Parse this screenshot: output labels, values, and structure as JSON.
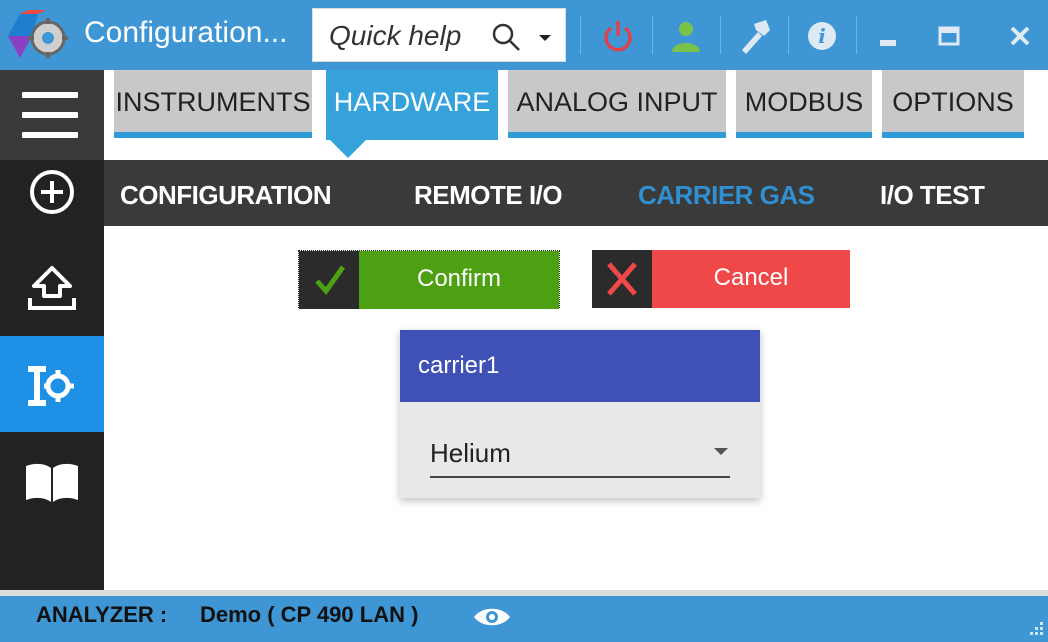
{
  "window": {
    "title": "Configuration...",
    "quick_help_placeholder": "Quick help",
    "icons": [
      "app-logo-icon",
      "search-icon",
      "chevron-down-icon",
      "power-icon",
      "user-icon",
      "tools-icon",
      "info-icon",
      "minimize-icon",
      "maximize-icon",
      "close-icon"
    ]
  },
  "sidebar": {
    "items": [
      {
        "icon": "menu-icon"
      },
      {
        "icon": "add-icon"
      },
      {
        "icon": "upload-icon"
      },
      {
        "icon": "settings-tools-icon",
        "active": true
      },
      {
        "icon": "book-icon"
      }
    ]
  },
  "tabs": [
    {
      "label": "INSTRUMENTS"
    },
    {
      "label": "HARDWARE",
      "active": true
    },
    {
      "label": "ANALOG INPUT"
    },
    {
      "label": "MODBUS"
    },
    {
      "label": "OPTIONS"
    }
  ],
  "subtabs": [
    {
      "label": "CONFIGURATION"
    },
    {
      "label": "REMOTE I/O"
    },
    {
      "label": "CARRIER GAS",
      "active": true
    },
    {
      "label": "I/O TEST"
    }
  ],
  "actions": {
    "confirm_label": "Confirm",
    "cancel_label": "Cancel"
  },
  "card": {
    "title": "carrier1",
    "selected_gas": "Helium"
  },
  "status": {
    "label": "ANALYZER :",
    "value": "Demo ( CP 490 LAN )"
  },
  "colors": {
    "titlebar": "#3e97d4",
    "tab_active": "#35a2db",
    "confirm": "#4ca012",
    "cancel": "#f04848",
    "card_header": "#3f51b5"
  }
}
